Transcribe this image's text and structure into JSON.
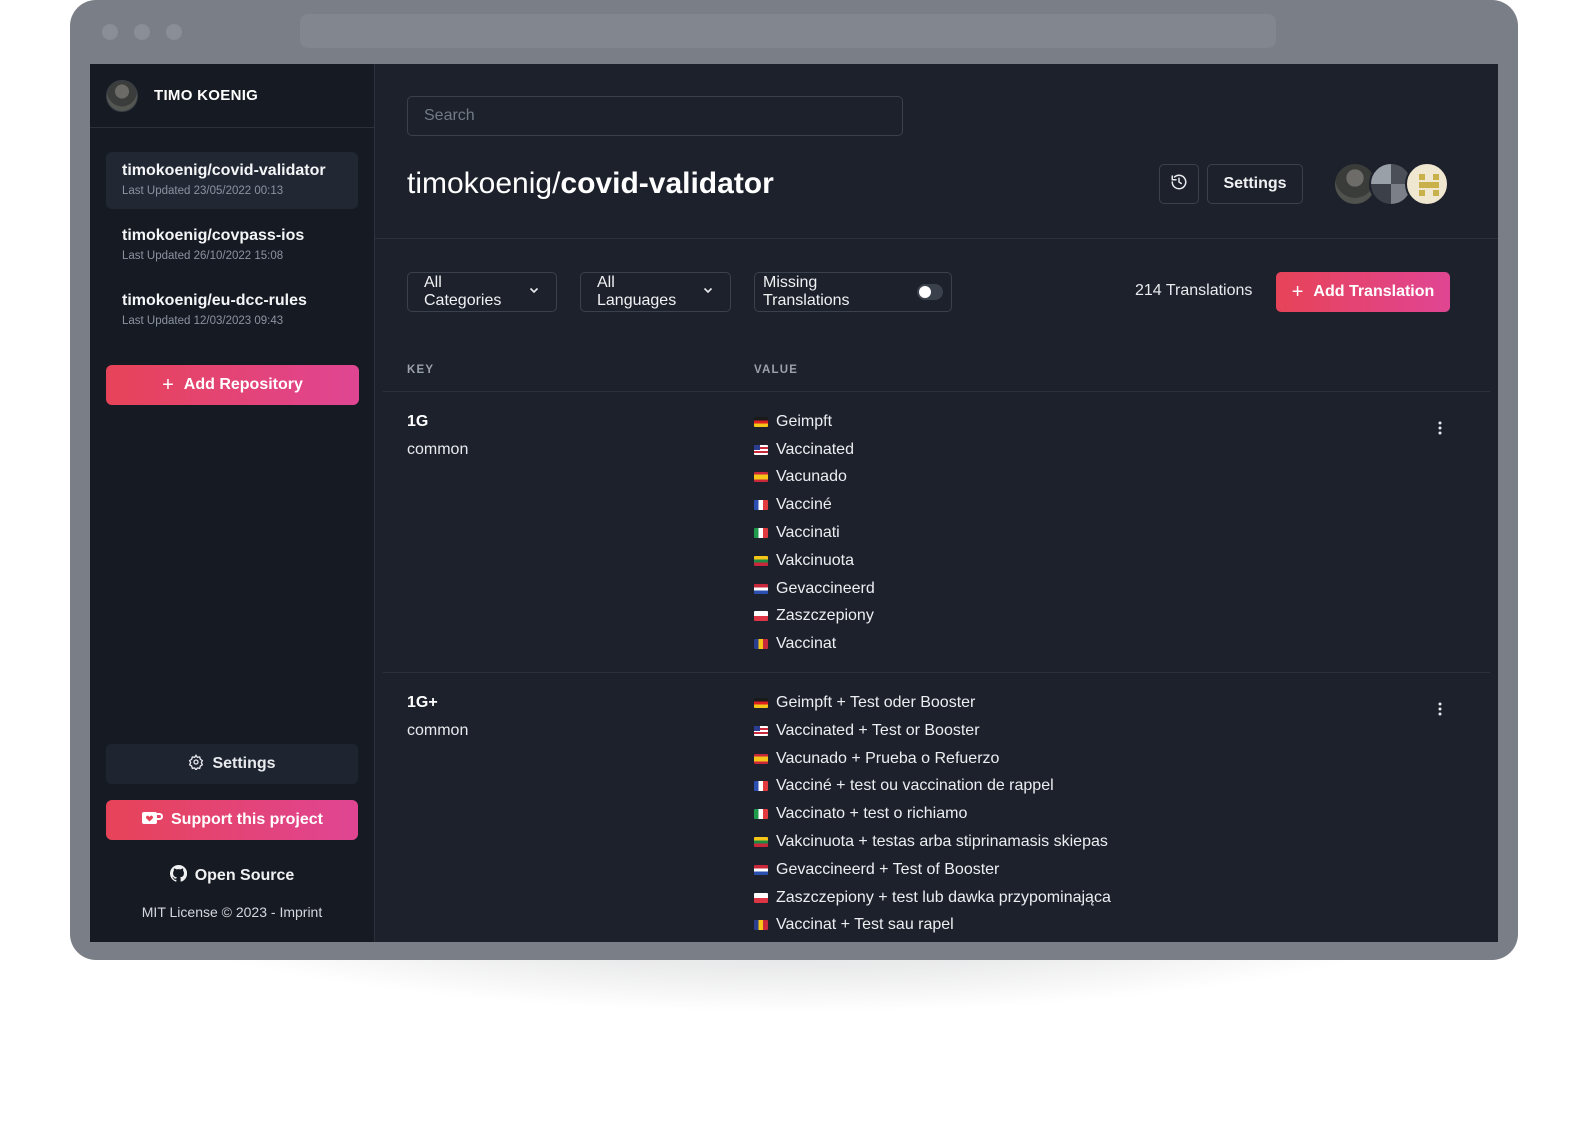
{
  "sidebar": {
    "user_name": "TIMO KOENIG",
    "repos": [
      {
        "name": "timokoenig/covid-validator",
        "updated": "Last Updated 23/05/2022 00:13"
      },
      {
        "name": "timokoenig/covpass-ios",
        "updated": "Last Updated 26/10/2022 15:08"
      },
      {
        "name": "timokoenig/eu-dcc-rules",
        "updated": "Last Updated 12/03/2023 09:43"
      }
    ],
    "add_repo_label": "Add Repository",
    "settings_label": "Settings",
    "support_label": "Support this project",
    "open_source_label": "Open Source",
    "license": "MIT License © 2023 - Imprint"
  },
  "header": {
    "search_placeholder": "Search",
    "owner": "timokoenig/",
    "repo": "covid-validator",
    "settings_label": "Settings"
  },
  "filters": {
    "categories": "All Categories",
    "languages": "All Languages",
    "missing": "Missing Translations",
    "missing_enabled": false
  },
  "count_label": "214 Translations",
  "add_translation_label": "Add Translation",
  "table": {
    "key_header": "KEY",
    "value_header": "VALUE",
    "rows": [
      {
        "key": "1G",
        "category": "common",
        "values": [
          {
            "flag": "de",
            "text": "Geimpft"
          },
          {
            "flag": "us",
            "text": "Vaccinated"
          },
          {
            "flag": "es",
            "text": "Vacunado"
          },
          {
            "flag": "fr",
            "text": "Vacciné"
          },
          {
            "flag": "it",
            "text": "Vaccinati"
          },
          {
            "flag": "lt",
            "text": "Vakcinuota"
          },
          {
            "flag": "nl",
            "text": "Gevaccineerd"
          },
          {
            "flag": "pl",
            "text": "Zaszczepiony"
          },
          {
            "flag": "ro",
            "text": "Vaccinat"
          }
        ]
      },
      {
        "key": "1G+",
        "category": "common",
        "values": [
          {
            "flag": "de",
            "text": "Geimpft + Test oder Booster"
          },
          {
            "flag": "us",
            "text": "Vaccinated + Test or Booster"
          },
          {
            "flag": "es",
            "text": "Vacunado + Prueba o Refuerzo"
          },
          {
            "flag": "fr",
            "text": "Vacciné + test ou vaccination de rappel"
          },
          {
            "flag": "it",
            "text": "Vaccinato + test o richiamo"
          },
          {
            "flag": "lt",
            "text": "Vakcinuota + testas arba stiprinamasis skiepas"
          },
          {
            "flag": "nl",
            "text": "Gevaccineerd + Test of Booster"
          },
          {
            "flag": "pl",
            "text": "Zaszczepiony + test lub dawka przypominająca"
          },
          {
            "flag": "ro",
            "text": "Vaccinat + Test sau rapel"
          }
        ]
      }
    ]
  },
  "colors": {
    "accent_start": "#e74358",
    "accent_end": "#e04593",
    "background": "#1c212b",
    "sidebar": "#161a22"
  }
}
